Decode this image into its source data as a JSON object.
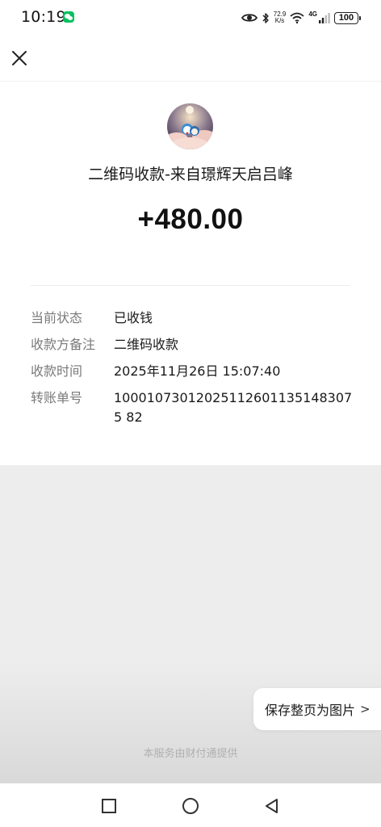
{
  "status_bar": {
    "time": "10:19",
    "net_speed_value": "72.9",
    "net_speed_unit": "K/s",
    "network_type": "4G",
    "battery": "100"
  },
  "header": {
    "close_icon": "close-icon"
  },
  "transaction": {
    "title": "二维码收款-来自璟辉天启吕峰",
    "amount": "+480.00",
    "details": [
      {
        "label": "当前状态",
        "value": "已收钱"
      },
      {
        "label": "收款方备注",
        "value": "二维码收款"
      },
      {
        "label": "收款时间",
        "value": "2025年11月26日 15:07:40"
      },
      {
        "label": "转账单号",
        "value": "100010730120251126011351483075 82"
      }
    ]
  },
  "actions": {
    "save_label": "保存整页为图片",
    "save_chevron": ">"
  },
  "footer": {
    "provider_text": "本服务由财付通提供"
  },
  "nav": {
    "icons": [
      "square-recent-icon",
      "circle-home-icon",
      "triangle-back-icon"
    ]
  },
  "colors": {
    "background": "#ededed",
    "card": "#ffffff",
    "label_gray": "#7a7a7a",
    "wechat_green": "#07c160"
  }
}
